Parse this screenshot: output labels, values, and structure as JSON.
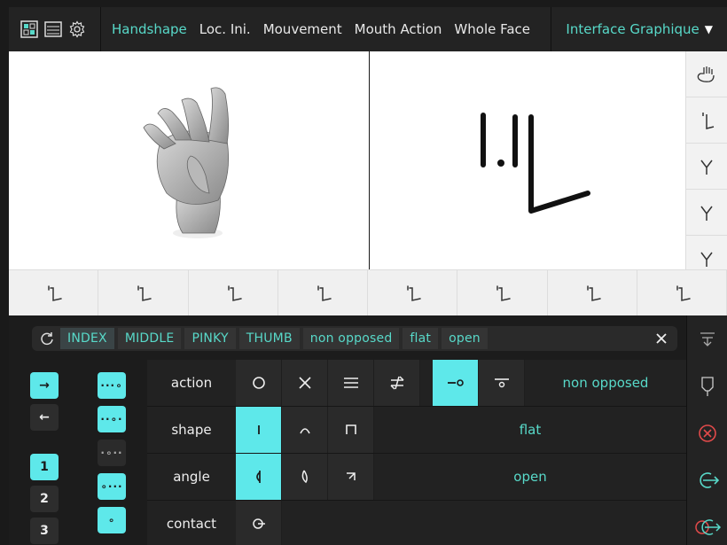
{
  "topbar": {
    "icons": [
      "grid-square-icon",
      "list-icon",
      "gear-icon"
    ],
    "tabs": [
      {
        "label": "Handshape",
        "active": true
      },
      {
        "label": "Loc. Ini.",
        "active": false
      },
      {
        "label": "Mouvement",
        "active": false
      },
      {
        "label": "Mouth Action",
        "active": false
      },
      {
        "label": "Whole Face",
        "active": false
      }
    ],
    "language": "Interface Graphique",
    "language_caret": "▼"
  },
  "colors": {
    "accent": "#58d9c9",
    "button_cyan": "#5ee8ea",
    "error_red": "#e04a4a"
  },
  "symbol_strip_count": 8,
  "right_strip_icons": [
    "hand-outline-icon",
    "hook-symbol-icon",
    "fork-symbol-icon",
    "fork-symbol-icon",
    "fork-symbol-icon"
  ],
  "filter": {
    "chips": [
      "INDEX",
      "MIDDLE",
      "PINKY",
      "THUMB",
      "non opposed",
      "flat",
      "open"
    ]
  },
  "direction_buttons": [
    "→",
    "←"
  ],
  "number_buttons": [
    "1",
    "2",
    "3"
  ],
  "dot_buttons": [
    "···∘",
    "··∘·",
    "·∘··",
    "∘···",
    "∘"
  ],
  "grid": {
    "rows": [
      {
        "label": "action",
        "value": "non opposed"
      },
      {
        "label": "shape",
        "value": "flat"
      },
      {
        "label": "angle",
        "value": "open"
      },
      {
        "label": "contact",
        "value": ""
      }
    ]
  }
}
